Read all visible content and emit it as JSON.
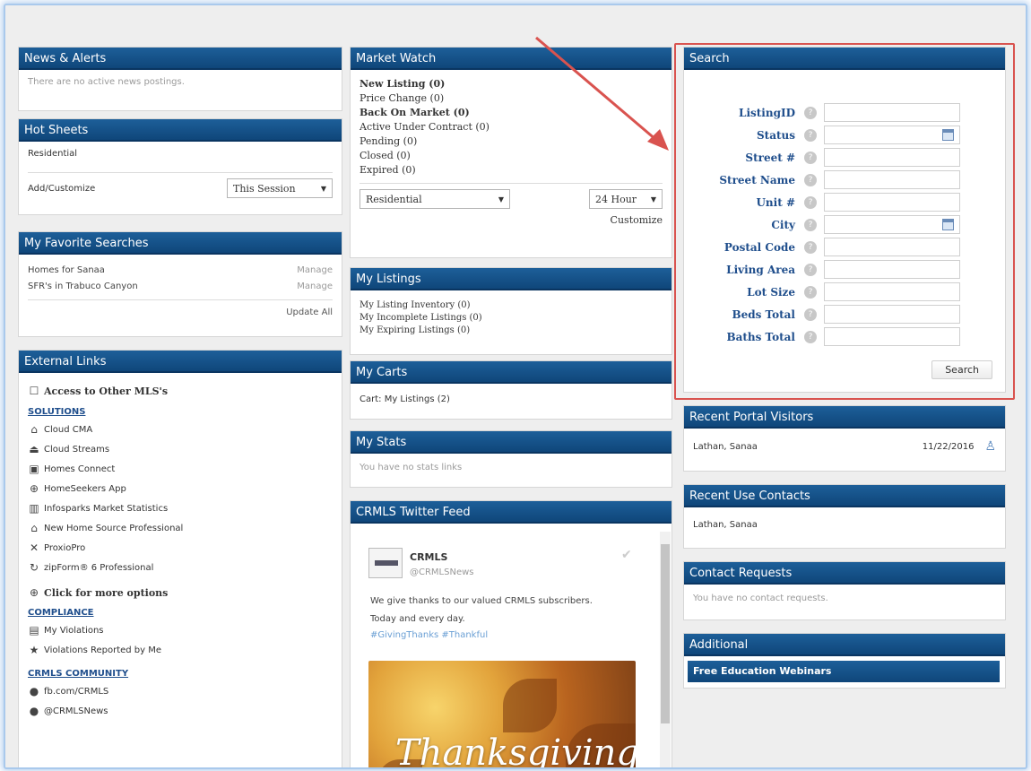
{
  "left": {
    "news": {
      "title": "News & Alerts",
      "empty": "There are no active news postings."
    },
    "hot_sheets": {
      "title": "Hot Sheets",
      "row1": "Residential",
      "row2_label": "Add/Customize",
      "session_select": "This Session"
    },
    "favorites": {
      "title": "My Favorite Searches",
      "items": [
        {
          "name": "Homes for Sanaa",
          "action": "Manage"
        },
        {
          "name": "SFR's in Trabuco Canyon",
          "action": "Manage"
        }
      ],
      "update_all": "Update All"
    },
    "external": {
      "title": "External Links",
      "access_other": "Access to Other MLS's",
      "solutions_heading": "SOLUTIONS",
      "solutions": [
        {
          "label": "Cloud CMA",
          "icon": "cloud-cma-icon"
        },
        {
          "label": "Cloud Streams",
          "icon": "cloud-streams-icon"
        },
        {
          "label": "Homes Connect",
          "icon": "homes-connect-icon"
        },
        {
          "label": "HomeSeekers App",
          "icon": "homeseekers-icon"
        },
        {
          "label": "Infosparks Market Statistics",
          "icon": "bar-chart-icon"
        },
        {
          "label": "New Home Source Professional",
          "icon": "house-icon"
        },
        {
          "label": "ProxioPro",
          "icon": "proxio-icon"
        },
        {
          "label": "zipForm® 6 Professional",
          "icon": "zipform-icon"
        }
      ],
      "more_options": "Click for more options",
      "compliance_heading": "COMPLIANCE",
      "compliance": [
        {
          "label": "My Violations",
          "icon": "document-icon"
        },
        {
          "label": "Violations Reported by Me",
          "icon": "star-icon"
        }
      ],
      "community_heading": "CRMLS COMMUNITY",
      "community": [
        {
          "label": "fb.com/CRMLS",
          "icon": "facebook-icon"
        },
        {
          "label": "@CRMLSNews",
          "icon": "twitter-icon"
        }
      ]
    }
  },
  "middle": {
    "market_watch": {
      "title": "Market Watch",
      "lines": [
        "New Listing (0)",
        "Price Change (0)",
        "Back On Market (0)",
        "Active Under Contract (0)",
        "Pending (0)",
        "Closed (0)",
        "Expired (0)"
      ],
      "type_select": "Residential",
      "period_select": "24 Hour",
      "customize": "Customize"
    },
    "my_listings": {
      "title": "My Listings",
      "lines": [
        "My Listing Inventory (0)",
        "My Incomplete Listings  (0)",
        "My Expiring Listings (0)"
      ]
    },
    "my_carts": {
      "title": "My Carts",
      "line": "Cart: My Listings (2)"
    },
    "my_stats": {
      "title": "My Stats",
      "empty": "You have no stats links"
    },
    "twitter": {
      "title": "CRMLS Twitter Feed",
      "account": "CRMLS",
      "handle": "@CRMLSNews",
      "text": "We give thanks to our valued CRMLS subscribers. Today and every day.",
      "tags": "#GivingThanks #Thankful",
      "image_text": "Thanksgiving"
    }
  },
  "right": {
    "search": {
      "title": "Search",
      "fields": [
        {
          "label": "ListingID",
          "picker": false
        },
        {
          "label": "Status",
          "picker": true
        },
        {
          "label": "Street #",
          "picker": false
        },
        {
          "label": "Street Name",
          "picker": false
        },
        {
          "label": "Unit #",
          "picker": false
        },
        {
          "label": "City",
          "picker": true
        },
        {
          "label": "Postal Code",
          "picker": false
        },
        {
          "label": "Living Area",
          "picker": false
        },
        {
          "label": "Lot Size",
          "picker": false
        },
        {
          "label": "Beds Total",
          "picker": false
        },
        {
          "label": "Baths Total",
          "picker": false
        }
      ],
      "button": "Search"
    },
    "portal": {
      "title": "Recent Portal Visitors",
      "name": "Lathan, Sanaa",
      "date": "11/22/2016"
    },
    "contacts": {
      "title": "Recent Use Contacts",
      "name": "Lathan, Sanaa"
    },
    "requests": {
      "title": "Contact Requests",
      "empty": "You have no contact requests."
    },
    "additional": {
      "title": "Additional",
      "item": "Free Education Webinars"
    }
  },
  "colors": {
    "header": "#15508a",
    "highlight": "#d9534f",
    "link": "#1f4e8c"
  }
}
